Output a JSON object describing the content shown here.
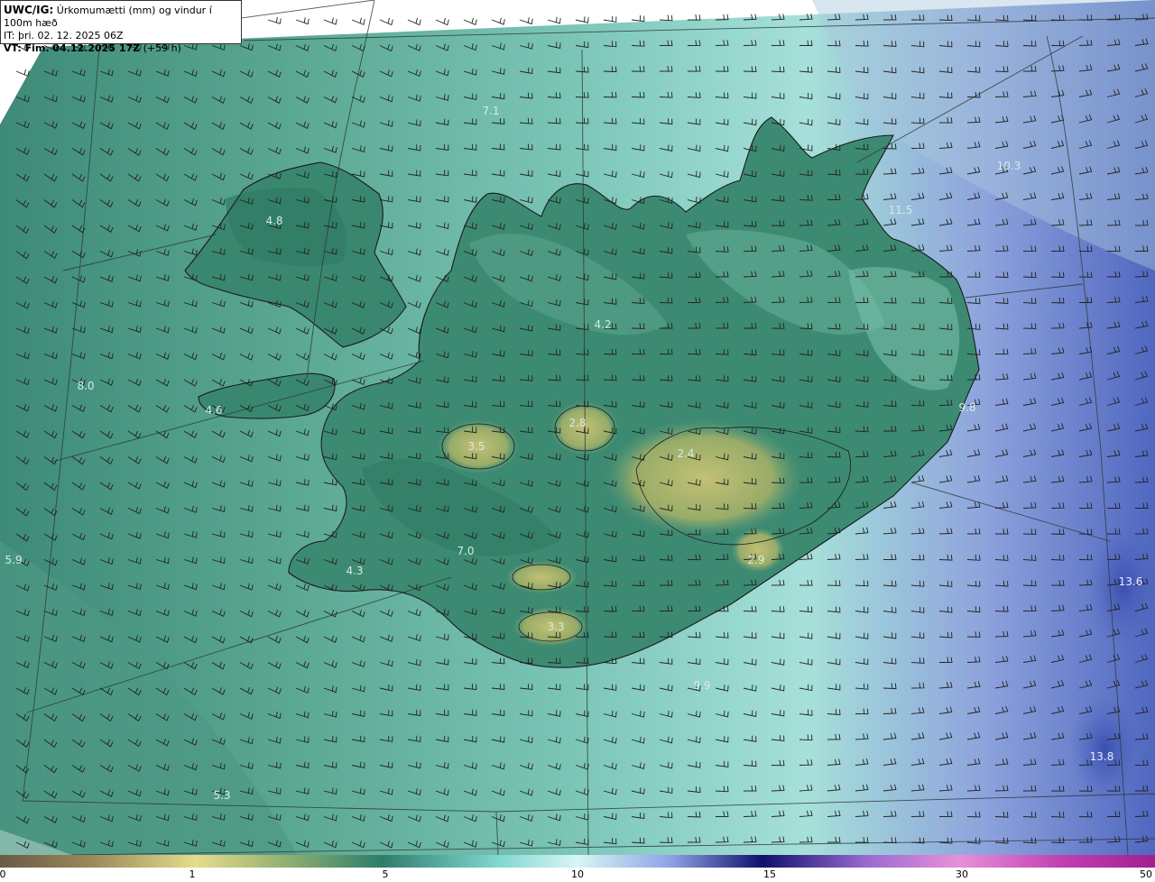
{
  "header": {
    "product_tag": "UWC/IG:",
    "product_desc": "Úrkomumætti (mm) og vindur í 100m hæð",
    "issue_time": "IT: þri. 02. 12. 2025 06Z",
    "valid_tag": "VT: Fim. 04.12.2025 17Z",
    "valid_offset": "(+59 h)"
  },
  "colorbar": {
    "ticks": [
      "0",
      "1",
      "5",
      "10",
      "15",
      "30",
      "50"
    ],
    "stops": [
      "#6b5a45",
      "#9a8a5a",
      "#e6dc8c",
      "#8fae6e",
      "#2e7d6b",
      "#7fd6cf",
      "#d8f6f4",
      "#8fa3e6",
      "#3a3fb0",
      "#10106a",
      "#9a6ad0",
      "#e890d8",
      "#c040b0",
      "#a02090"
    ]
  },
  "map_values": [
    {
      "text": "7.1",
      "dark": false
    },
    {
      "text": "4.8",
      "dark": false
    },
    {
      "text": "4.2",
      "dark": false
    },
    {
      "text": "8.0",
      "dark": false
    },
    {
      "text": "4.6",
      "dark": false
    },
    {
      "text": "3.5",
      "dark": false
    },
    {
      "text": "2.8",
      "dark": false
    },
    {
      "text": "2.4",
      "dark": false
    },
    {
      "text": "7.0",
      "dark": false
    },
    {
      "text": "4.3",
      "dark": false
    },
    {
      "text": "3.3",
      "dark": false
    },
    {
      "text": "2.9",
      "dark": false
    },
    {
      "text": "9.9",
      "dark": false
    },
    {
      "text": "5.9",
      "dark": false
    },
    {
      "text": "5.3",
      "dark": false
    },
    {
      "text": "13.6",
      "dark": true
    },
    {
      "text": "13.8",
      "dark": true
    },
    {
      "text": "10.3",
      "dark": false
    },
    {
      "text": "11.5",
      "dark": false
    },
    {
      "text": "9.8",
      "dark": false
    }
  ],
  "colors": {
    "land_low": "#2f7a66",
    "land_mid": "#4f9a82",
    "highland": "#a8b56a",
    "sea_west": "#5aa792",
    "sea_east": "#8ea4dc",
    "sea_far_east": "#5067c0",
    "barb": "#222222",
    "coast": "#1a1a1a"
  }
}
